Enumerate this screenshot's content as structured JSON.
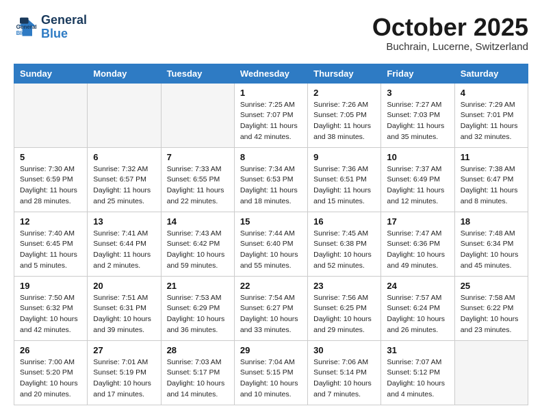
{
  "header": {
    "logo_line1": "General",
    "logo_line2": "Blue",
    "month_title": "October 2025",
    "location": "Buchrain, Lucerne, Switzerland"
  },
  "weekdays": [
    "Sunday",
    "Monday",
    "Tuesday",
    "Wednesday",
    "Thursday",
    "Friday",
    "Saturday"
  ],
  "weeks": [
    [
      {
        "day": "",
        "info": ""
      },
      {
        "day": "",
        "info": ""
      },
      {
        "day": "",
        "info": ""
      },
      {
        "day": "1",
        "info": "Sunrise: 7:25 AM\nSunset: 7:07 PM\nDaylight: 11 hours\nand 42 minutes."
      },
      {
        "day": "2",
        "info": "Sunrise: 7:26 AM\nSunset: 7:05 PM\nDaylight: 11 hours\nand 38 minutes."
      },
      {
        "day": "3",
        "info": "Sunrise: 7:27 AM\nSunset: 7:03 PM\nDaylight: 11 hours\nand 35 minutes."
      },
      {
        "day": "4",
        "info": "Sunrise: 7:29 AM\nSunset: 7:01 PM\nDaylight: 11 hours\nand 32 minutes."
      }
    ],
    [
      {
        "day": "5",
        "info": "Sunrise: 7:30 AM\nSunset: 6:59 PM\nDaylight: 11 hours\nand 28 minutes."
      },
      {
        "day": "6",
        "info": "Sunrise: 7:32 AM\nSunset: 6:57 PM\nDaylight: 11 hours\nand 25 minutes."
      },
      {
        "day": "7",
        "info": "Sunrise: 7:33 AM\nSunset: 6:55 PM\nDaylight: 11 hours\nand 22 minutes."
      },
      {
        "day": "8",
        "info": "Sunrise: 7:34 AM\nSunset: 6:53 PM\nDaylight: 11 hours\nand 18 minutes."
      },
      {
        "day": "9",
        "info": "Sunrise: 7:36 AM\nSunset: 6:51 PM\nDaylight: 11 hours\nand 15 minutes."
      },
      {
        "day": "10",
        "info": "Sunrise: 7:37 AM\nSunset: 6:49 PM\nDaylight: 11 hours\nand 12 minutes."
      },
      {
        "day": "11",
        "info": "Sunrise: 7:38 AM\nSunset: 6:47 PM\nDaylight: 11 hours\nand 8 minutes."
      }
    ],
    [
      {
        "day": "12",
        "info": "Sunrise: 7:40 AM\nSunset: 6:45 PM\nDaylight: 11 hours\nand 5 minutes."
      },
      {
        "day": "13",
        "info": "Sunrise: 7:41 AM\nSunset: 6:44 PM\nDaylight: 11 hours\nand 2 minutes."
      },
      {
        "day": "14",
        "info": "Sunrise: 7:43 AM\nSunset: 6:42 PM\nDaylight: 10 hours\nand 59 minutes."
      },
      {
        "day": "15",
        "info": "Sunrise: 7:44 AM\nSunset: 6:40 PM\nDaylight: 10 hours\nand 55 minutes."
      },
      {
        "day": "16",
        "info": "Sunrise: 7:45 AM\nSunset: 6:38 PM\nDaylight: 10 hours\nand 52 minutes."
      },
      {
        "day": "17",
        "info": "Sunrise: 7:47 AM\nSunset: 6:36 PM\nDaylight: 10 hours\nand 49 minutes."
      },
      {
        "day": "18",
        "info": "Sunrise: 7:48 AM\nSunset: 6:34 PM\nDaylight: 10 hours\nand 45 minutes."
      }
    ],
    [
      {
        "day": "19",
        "info": "Sunrise: 7:50 AM\nSunset: 6:32 PM\nDaylight: 10 hours\nand 42 minutes."
      },
      {
        "day": "20",
        "info": "Sunrise: 7:51 AM\nSunset: 6:31 PM\nDaylight: 10 hours\nand 39 minutes."
      },
      {
        "day": "21",
        "info": "Sunrise: 7:53 AM\nSunset: 6:29 PM\nDaylight: 10 hours\nand 36 minutes."
      },
      {
        "day": "22",
        "info": "Sunrise: 7:54 AM\nSunset: 6:27 PM\nDaylight: 10 hours\nand 33 minutes."
      },
      {
        "day": "23",
        "info": "Sunrise: 7:56 AM\nSunset: 6:25 PM\nDaylight: 10 hours\nand 29 minutes."
      },
      {
        "day": "24",
        "info": "Sunrise: 7:57 AM\nSunset: 6:24 PM\nDaylight: 10 hours\nand 26 minutes."
      },
      {
        "day": "25",
        "info": "Sunrise: 7:58 AM\nSunset: 6:22 PM\nDaylight: 10 hours\nand 23 minutes."
      }
    ],
    [
      {
        "day": "26",
        "info": "Sunrise: 7:00 AM\nSunset: 5:20 PM\nDaylight: 10 hours\nand 20 minutes."
      },
      {
        "day": "27",
        "info": "Sunrise: 7:01 AM\nSunset: 5:19 PM\nDaylight: 10 hours\nand 17 minutes."
      },
      {
        "day": "28",
        "info": "Sunrise: 7:03 AM\nSunset: 5:17 PM\nDaylight: 10 hours\nand 14 minutes."
      },
      {
        "day": "29",
        "info": "Sunrise: 7:04 AM\nSunset: 5:15 PM\nDaylight: 10 hours\nand 10 minutes."
      },
      {
        "day": "30",
        "info": "Sunrise: 7:06 AM\nSunset: 5:14 PM\nDaylight: 10 hours\nand 7 minutes."
      },
      {
        "day": "31",
        "info": "Sunrise: 7:07 AM\nSunset: 5:12 PM\nDaylight: 10 hours\nand 4 minutes."
      },
      {
        "day": "",
        "info": ""
      }
    ]
  ]
}
